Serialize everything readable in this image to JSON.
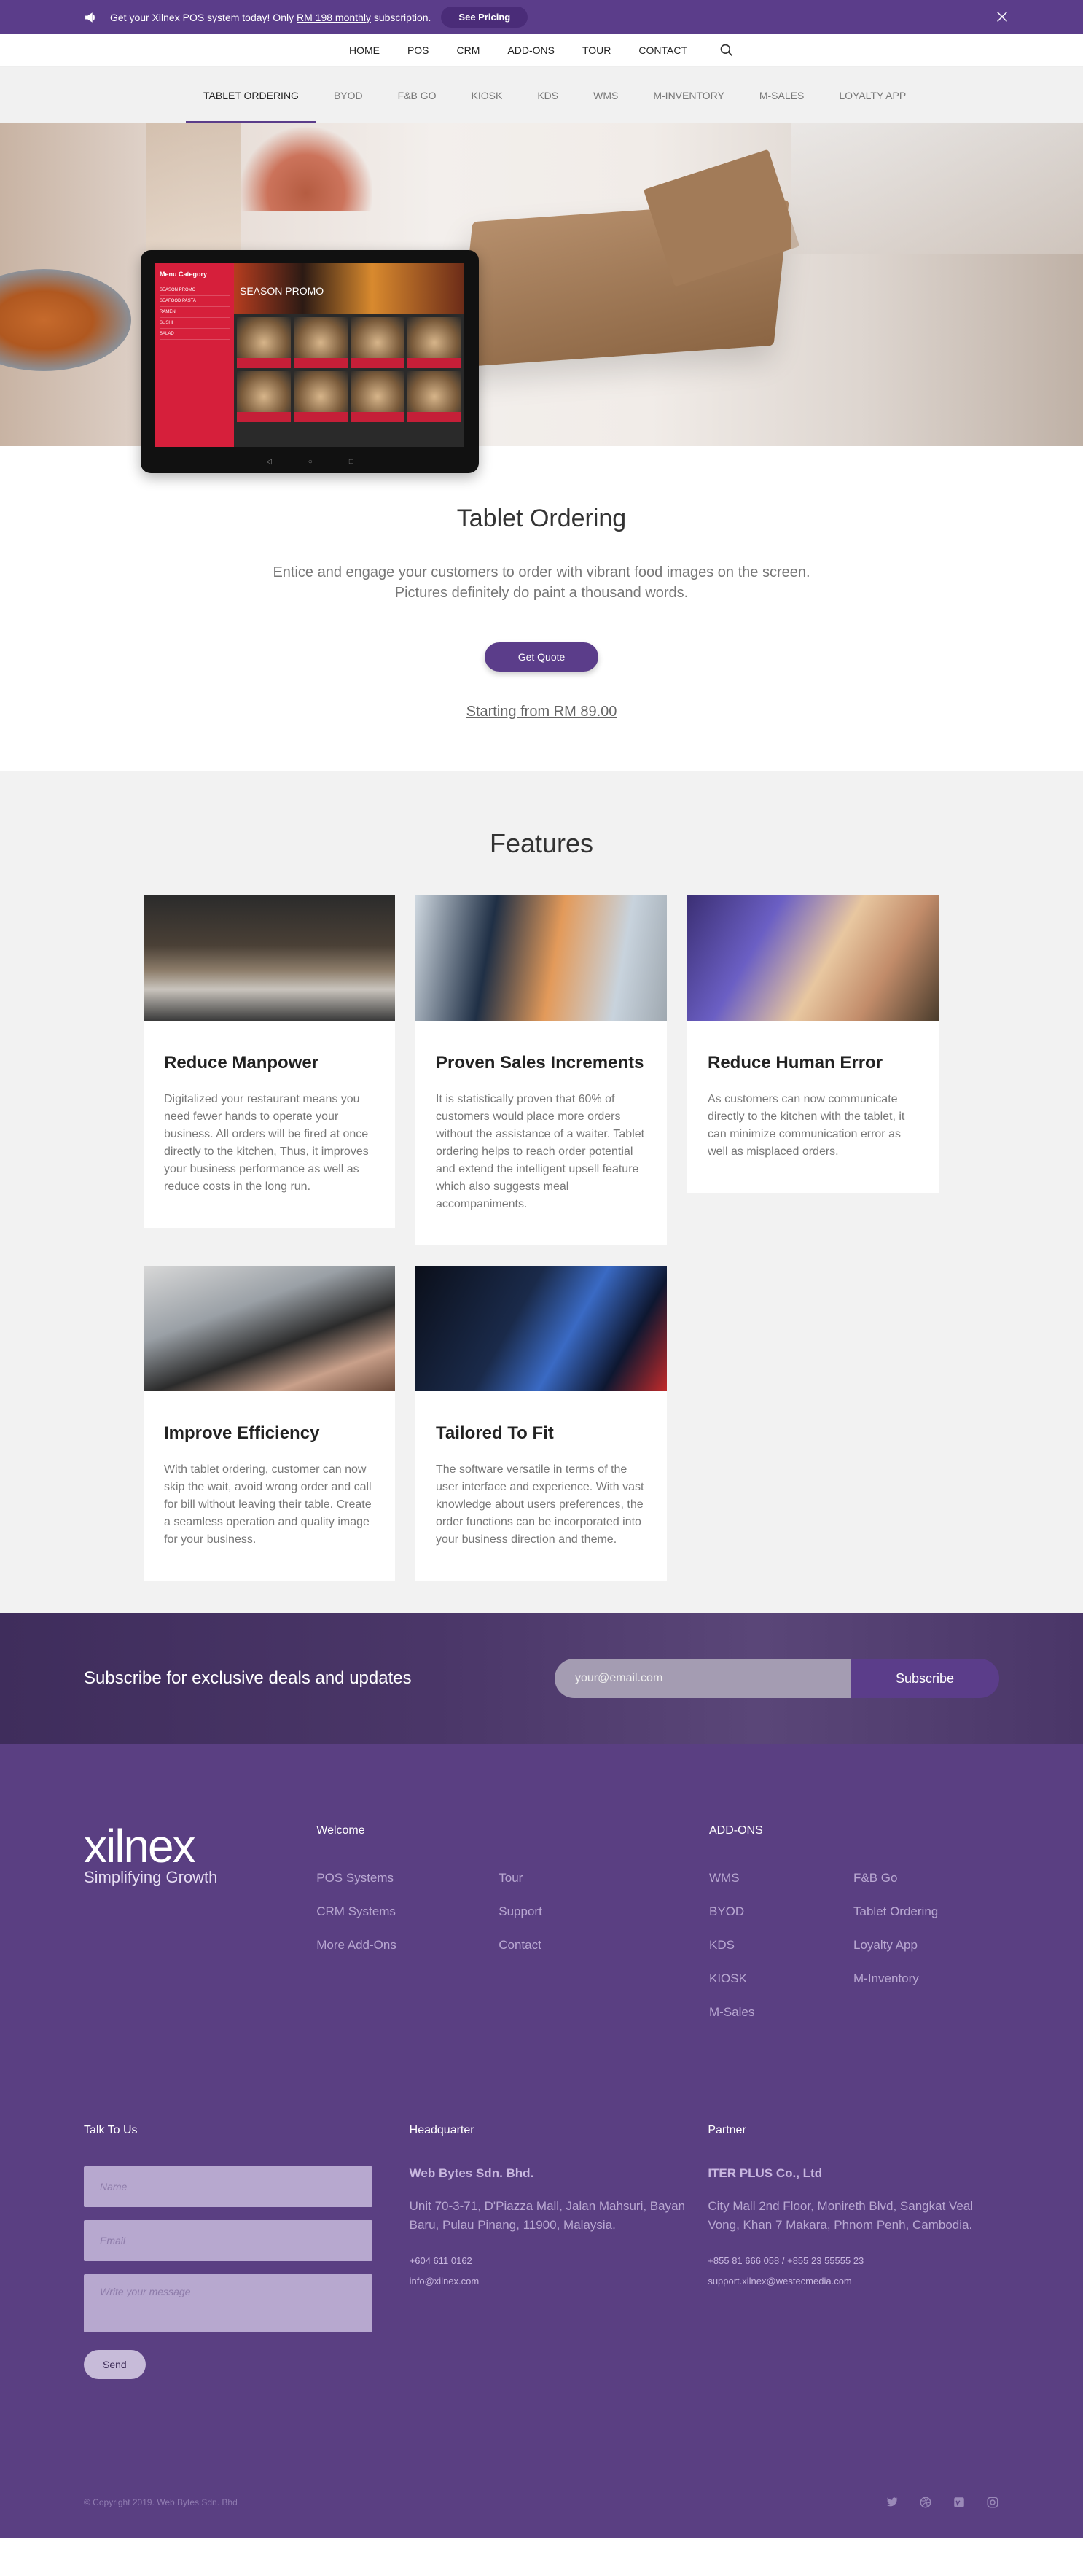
{
  "promo": {
    "text_before": "Get your Xilnex POS system today! Only ",
    "text_link": "RM 198 monthly",
    "text_after": " subscription.",
    "button": "See Pricing"
  },
  "main_nav": [
    "HOME",
    "POS",
    "CRM",
    "ADD-ONS",
    "TOUR",
    "CONTACT"
  ],
  "sub_nav": [
    "TABLET ORDERING",
    "BYOD",
    "F&B GO",
    "KIOSK",
    "KDS",
    "WMS",
    "M-INVENTORY",
    "M-SALES",
    "LOYALTY APP"
  ],
  "tablet": {
    "menu_category": "Menu Category",
    "banner": "SEASON PROMO",
    "side_items": [
      "SEASON PROMO",
      "SEAFOOD PASTA",
      "RAMEN",
      "SUSHI",
      "SALAD"
    ]
  },
  "intro": {
    "title": "Tablet Ordering",
    "line1": "Entice and engage your customers to order with vibrant food images on the screen.",
    "line2": "Pictures definitely do paint a thousand words.",
    "button": "Get Quote",
    "starting": "Starting from RM 89.00"
  },
  "features": {
    "title": "Features",
    "cards": [
      {
        "title": "Reduce Manpower",
        "text": "Digitalized your restaurant means you need fewer hands to operate your business. All orders will be fired at once directly to the kitchen, Thus, it improves your business performance as well as reduce costs in the long run."
      },
      {
        "title": "Proven Sales Increments",
        "text": "It is statistically proven that 60% of customers would place more orders without the assistance of a waiter. Tablet ordering helps to reach order potential and extend the intelligent upsell feature which also suggests meal accompaniments."
      },
      {
        "title": "Reduce Human Error",
        "text": "As customers can now communicate directly to the kitchen with the tablet, it can minimize communication error as well as misplaced orders."
      },
      {
        "title": "Improve Efficiency",
        "text": "With tablet ordering, customer can now skip the wait, avoid wrong order and call for bill without leaving their table. Create a seamless operation and quality image for your business."
      },
      {
        "title": "Tailored To Fit",
        "text": "The software versatile in terms of the user interface and experience. With vast knowledge about users preferences, the order functions can be incorporated into your business direction and theme."
      }
    ]
  },
  "subscribe": {
    "title": "Subscribe for exclusive deals and updates",
    "placeholder": "your@email.com",
    "button": "Subscribe"
  },
  "footer": {
    "logo_name": "xilnex",
    "logo_tag": "Simplifying Growth",
    "welcome": {
      "title": "Welcome",
      "links": [
        "POS Systems",
        "Tour",
        "CRM Systems",
        "Support",
        "More Add-Ons",
        "Contact"
      ]
    },
    "addons": {
      "title": "ADD-ONS",
      "links": [
        "WMS",
        "F&B Go",
        "BYOD",
        "Tablet Ordering",
        "KDS",
        "Loyalty App",
        "KIOSK",
        "M-Inventory",
        "M-Sales"
      ]
    },
    "talk": {
      "title": "Talk To Us",
      "name": "Name",
      "email": "Email",
      "message": "Write your message",
      "send": "Send"
    },
    "hq": {
      "title": "Headquarter",
      "company": "Web Bytes Sdn. Bhd.",
      "address": "Unit 70-3-71, D'Piazza Mall, Jalan Mahsuri, Bayan Baru, Pulau Pinang, 11900, Malaysia.",
      "phone": "+604 611 0162",
      "email": "info@xilnex.com"
    },
    "partner": {
      "title": "Partner",
      "company": "ITER PLUS Co., Ltd",
      "address": "City Mall 2nd Floor, Monireth Blvd, Sangkat Veal Vong, Khan 7 Makara, Phnom Penh, Cambodia.",
      "phone": "+855 81 666 058  /  +855 23 55555 23",
      "email": "support.xilnex@westecmedia.com"
    },
    "copyright": "© Copyright 2019. Web Bytes Sdn. Bhd"
  }
}
